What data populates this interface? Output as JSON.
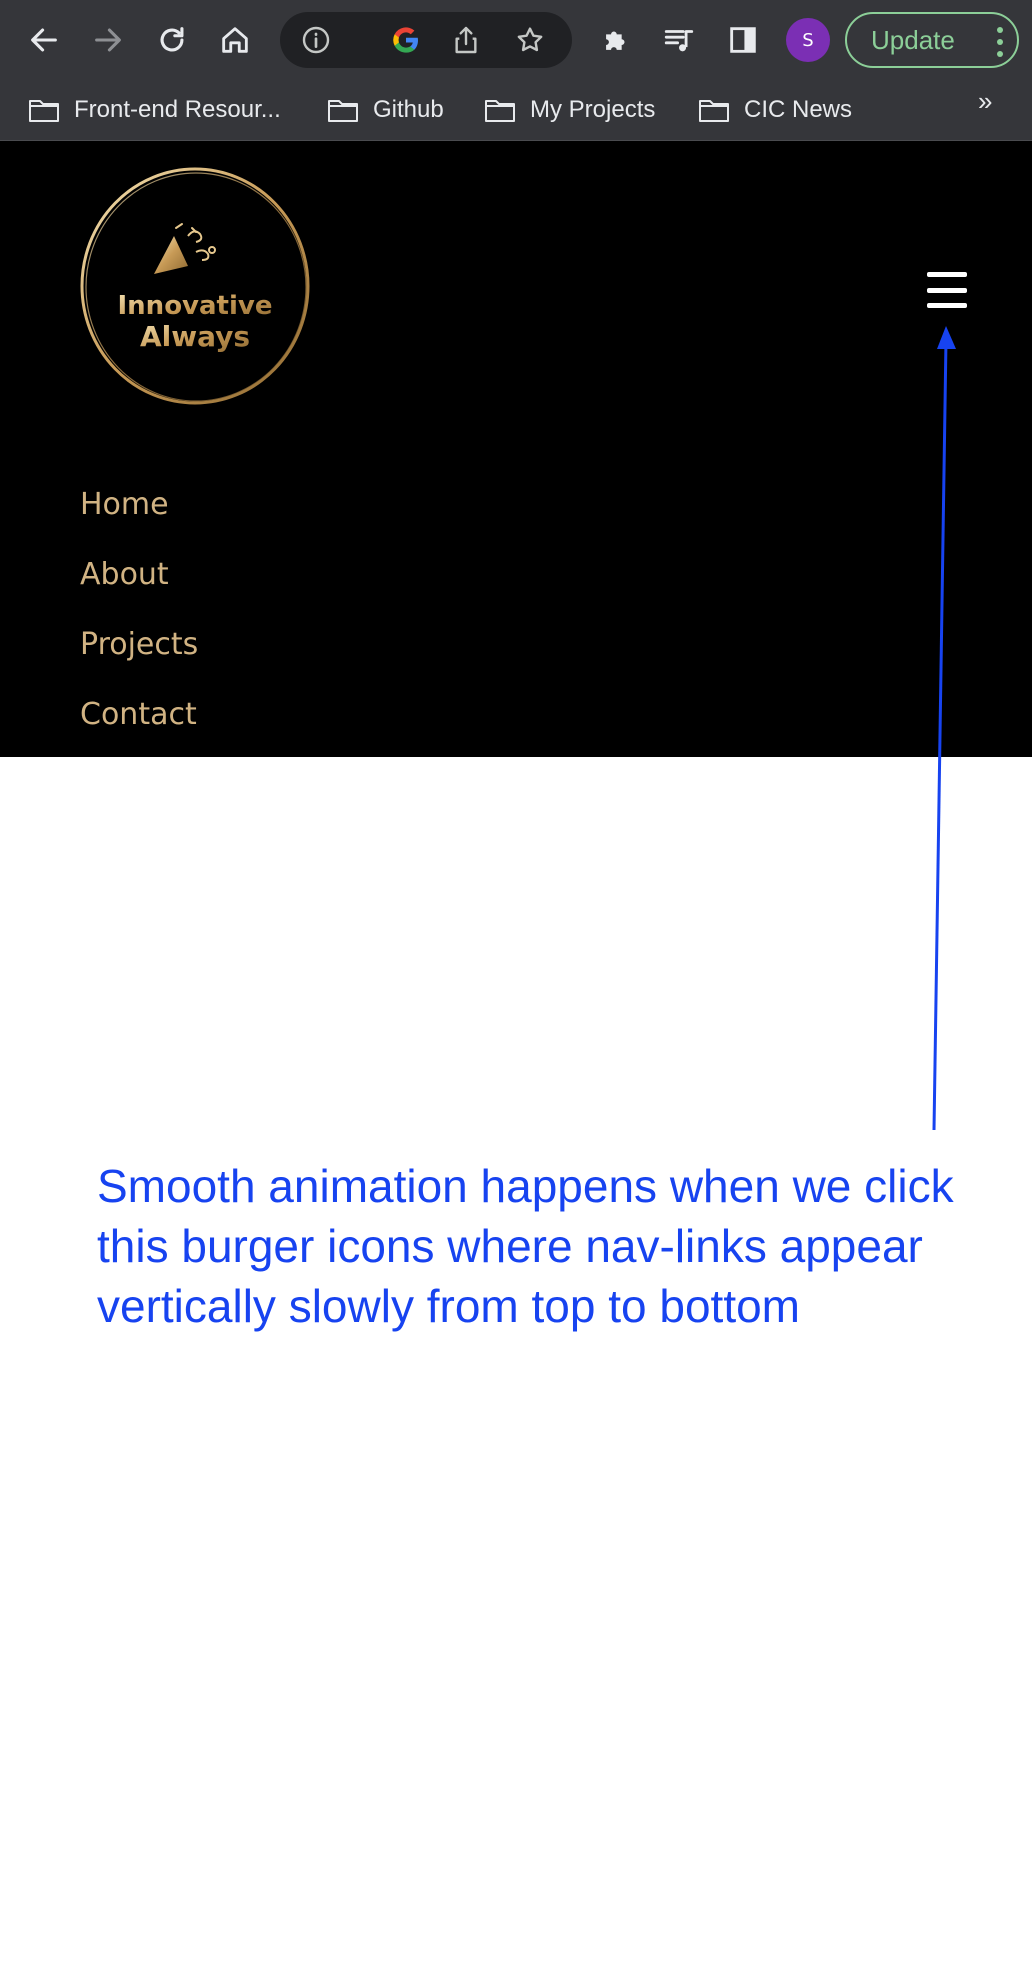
{
  "browser": {
    "avatar_initial": "S",
    "update_label": "Update",
    "bookmarks": [
      {
        "label": "Front-end Resour..."
      },
      {
        "label": "Github"
      },
      {
        "label": "My Projects"
      },
      {
        "label": "CIC News"
      }
    ],
    "bookmarks_overflow": "»",
    "colors": {
      "chrome_bg": "#35363a",
      "omnibox_bg": "#202124",
      "update_accent": "#8ccf98",
      "avatar_bg": "#7b2fb4"
    }
  },
  "site": {
    "logo": {
      "line1": "Innovative",
      "line2": "Always"
    },
    "nav_links": [
      "Home",
      "About",
      "Projects",
      "Contact"
    ],
    "colors": {
      "header_bg": "#000000",
      "gold": "#d1b383"
    }
  },
  "annotation": {
    "text": "Smooth animation happens when we click this burger icons where nav-links appear vertically slowly from top to bottom",
    "color": "#1743f0"
  }
}
